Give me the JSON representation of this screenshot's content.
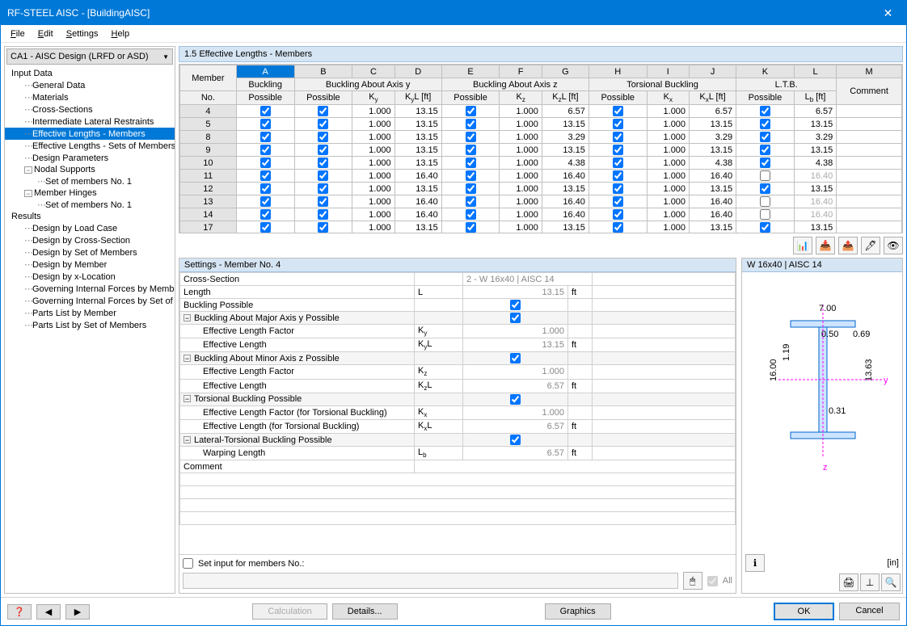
{
  "window": {
    "title": "RF-STEEL AISC - [BuildingAISC]"
  },
  "menu": {
    "file": "File",
    "edit": "Edit",
    "settings": "Settings",
    "help": "Help"
  },
  "combo": {
    "label": "CA1 - AISC Design (LRFD or ASD)"
  },
  "tree": {
    "input": "Input Data",
    "general": "General Data",
    "materials": "Materials",
    "cs": "Cross-Sections",
    "ilr": "Intermediate Lateral Restraints",
    "elm": "Effective Lengths - Members",
    "elsm": "Effective Lengths - Sets of Members",
    "dp": "Design Parameters",
    "ns": "Nodal Supports",
    "ns_sub": "Set of members No. 1",
    "mh": "Member Hinges",
    "mh_sub": "Set of members No. 1",
    "results": "Results",
    "r1": "Design by Load Case",
    "r2": "Design by Cross-Section",
    "r3": "Design by Set of Members",
    "r4": "Design by Member",
    "r5": "Design by x-Location",
    "r6": "Governing Internal Forces by Member",
    "r7": "Governing Internal Forces by Set of Members",
    "r8": "Parts List by Member",
    "r9": "Parts List by Set of Members"
  },
  "section_title": "1.5 Effective Lengths - Members",
  "grid": {
    "letters": [
      "A",
      "B",
      "C",
      "D",
      "E",
      "F",
      "G",
      "H",
      "I",
      "J",
      "K",
      "L",
      "M"
    ],
    "group1": "Buckling",
    "group2": "Buckling About Axis y",
    "group3": "Buckling About Axis z",
    "group4": "Torsional Buckling",
    "group5": "L.T.B.",
    "h_member": "Member",
    "h_no": "No.",
    "h_possible": "Possible",
    "h_ky": "Ky",
    "h_kyl": "KyL [ft]",
    "h_kz": "Kz",
    "h_kzl": "KzL [ft]",
    "h_kx": "Kx",
    "h_kxl": "KxL [ft]",
    "h_lb": "Lb [ft]",
    "h_comment": "Comment",
    "rows": [
      {
        "no": "4",
        "ky": "1.000",
        "kyl": "13.15",
        "kz": "1.000",
        "kzl": "6.57",
        "kx": "1.000",
        "kxl": "6.57",
        "lb": "6.57",
        "ltb": true
      },
      {
        "no": "5",
        "ky": "1.000",
        "kyl": "13.15",
        "kz": "1.000",
        "kzl": "13.15",
        "kx": "1.000",
        "kxl": "13.15",
        "lb": "13.15",
        "ltb": true
      },
      {
        "no": "8",
        "ky": "1.000",
        "kyl": "13.15",
        "kz": "1.000",
        "kzl": "3.29",
        "kx": "1.000",
        "kxl": "3.29",
        "lb": "3.29",
        "ltb": true
      },
      {
        "no": "9",
        "ky": "1.000",
        "kyl": "13.15",
        "kz": "1.000",
        "kzl": "13.15",
        "kx": "1.000",
        "kxl": "13.15",
        "lb": "13.15",
        "ltb": true
      },
      {
        "no": "10",
        "ky": "1.000",
        "kyl": "13.15",
        "kz": "1.000",
        "kzl": "4.38",
        "kx": "1.000",
        "kxl": "4.38",
        "lb": "4.38",
        "ltb": true
      },
      {
        "no": "11",
        "ky": "1.000",
        "kyl": "16.40",
        "kz": "1.000",
        "kzl": "16.40",
        "kx": "1.000",
        "kxl": "16.40",
        "lb": "16.40",
        "ltb": false
      },
      {
        "no": "12",
        "ky": "1.000",
        "kyl": "13.15",
        "kz": "1.000",
        "kzl": "13.15",
        "kx": "1.000",
        "kxl": "13.15",
        "lb": "13.15",
        "ltb": true
      },
      {
        "no": "13",
        "ky": "1.000",
        "kyl": "16.40",
        "kz": "1.000",
        "kzl": "16.40",
        "kx": "1.000",
        "kxl": "16.40",
        "lb": "16.40",
        "ltb": false
      },
      {
        "no": "14",
        "ky": "1.000",
        "kyl": "16.40",
        "kz": "1.000",
        "kzl": "16.40",
        "kx": "1.000",
        "kxl": "16.40",
        "lb": "16.40",
        "ltb": false
      },
      {
        "no": "17",
        "ky": "1.000",
        "kyl": "13.15",
        "kz": "1.000",
        "kzl": "13.15",
        "kx": "1.000",
        "kxl": "13.15",
        "lb": "13.15",
        "ltb": true
      }
    ]
  },
  "settings": {
    "title": "Settings - Member No. 4",
    "cs_lbl": "Cross-Section",
    "cs_val": "2 - W 16x40 | AISC 14",
    "len_lbl": "Length",
    "len_sym": "L",
    "len_val": "13.15",
    "ft": "ft",
    "bp_lbl": "Buckling Possible",
    "bmy": "Buckling About Major Axis y Possible",
    "elf": "Effective Length Factor",
    "ky": "Ky",
    "ky_val": "1.000",
    "el": "Effective Length",
    "kyl": "KyL",
    "kyl_val": "13.15",
    "bmz": "Buckling About Minor Axis z Possible",
    "kz": "Kz",
    "kz_val": "1.000",
    "kzl": "KzL",
    "kzl_val": "6.57",
    "tb": "Torsional Buckling Possible",
    "elft": "Effective Length Factor (for Torsional Buckling)",
    "kx": "Kx",
    "kx_val": "1.000",
    "elt": "Effective Length (for Torsional Buckling)",
    "kxl": "KxL",
    "kxl_val": "6.57",
    "ltb": "Lateral-Torsional Buckling Possible",
    "wl": "Warping Length",
    "lb": "Lb",
    "lb_val": "6.57",
    "comment": "Comment",
    "set_input": "Set input for members No.:",
    "all": "All"
  },
  "preview": {
    "title": "W 16x40 | AISC 14",
    "unit": "[in]",
    "dim_w": "7.00",
    "dim_tf": "0.50",
    "dim_h": "16.00",
    "dim_d": "13.63",
    "dim_tw": "0.31",
    "dim_bf": "1.19",
    "dim_r": "0.69"
  },
  "footer": {
    "calculation": "Calculation",
    "details": "Details...",
    "graphics": "Graphics",
    "ok": "OK",
    "cancel": "Cancel"
  }
}
